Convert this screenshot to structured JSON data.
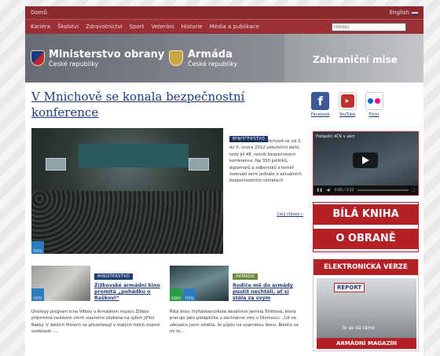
{
  "top": {
    "home": "Domů",
    "english": "English"
  },
  "nav": {
    "items": [
      "Kariéra",
      "Školství",
      "Zdravotnictví",
      "Sport",
      "Veteráni",
      "Historie",
      "Média a publikace"
    ],
    "search_placeholder": "Hledej"
  },
  "banner": {
    "mo_title": "Ministerstvo obrany",
    "mo_sub": "České republiky",
    "army_title": "Armáda",
    "army_sub": "České republiky",
    "missions": "Zahraniční mise"
  },
  "article": {
    "headline": "V Mnichově se konala bezpečnostní konference",
    "category": "MINISTERSTVO",
    "date": "6.2.2012",
    "text": "V Mnichově se od 3. do 5. února 2012 uskutečnil další, tedy již 48. ročník bezpečnostní konference. Na 350 politiků, diplomatů a odborníků z téměř šedesáti zemí jednalo o aktuálních bezpečnostních tématech.",
    "more": "Celý článek »",
    "photo_badge": "FOTO"
  },
  "social": {
    "facebook": "Facebook",
    "youtube": "YouTube",
    "flickr": "Flickr"
  },
  "video": {
    "title": "Potápěči AČR v akci",
    "time": "0:00 / 3:22"
  },
  "bila_kniha": {
    "line1": "BÍLÁ KNIHA",
    "line2": "O OBRANĚ"
  },
  "magazine": {
    "header": "ELEKTRONICKÁ VERZE",
    "report": "REPORT",
    "teaser": "To se dá rámo",
    "footer": "ARMÁDNÍ MAGAZÍN"
  },
  "stories": [
    {
      "category": "MINISTERSTVO",
      "title": "Žižkovské armádní kino promítá „pohádku o Raškovi“",
      "text": "Únorový program kina Vítkov v Armádním muzeu Žižkov připomíná nedávné úmrtí slavného skokana na lyžích Jiřího Rašky. V dalších filmech se představují v malých rolích známé osobnosti –...",
      "badge": "FOTO"
    },
    {
      "category": "ARMÁDA",
      "title": "Rodiče mě do armády pustit nechtěli, ať si stála za svým",
      "text": "Říká dnes čtyřiadvacetiletá desátnice Jarmila Šilitková, která pracuje jako potápěčka u záchranné roty v Olomouci. „Už na základce jsem věděla, že půjdu na vojenskou školu. Rodiče se mi to...",
      "badge_video": "VIDEO",
      "badge_foto": "FOTO"
    }
  ]
}
